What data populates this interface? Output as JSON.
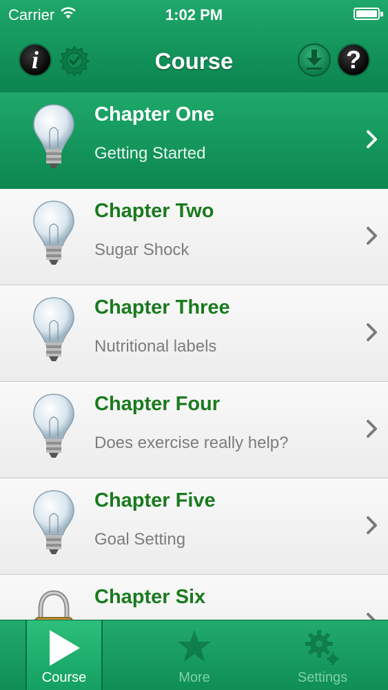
{
  "status_bar": {
    "carrier": "Carrier",
    "time": "1:02 PM"
  },
  "nav": {
    "title": "Course",
    "info_glyph": "i",
    "help_glyph": "?"
  },
  "chapters": [
    {
      "title": "Chapter One",
      "subtitle": "Getting Started",
      "icon": "lightbulb-icon",
      "selected": true
    },
    {
      "title": "Chapter Two",
      "subtitle": "Sugar Shock",
      "icon": "lightbulb-icon",
      "selected": false
    },
    {
      "title": "Chapter Three",
      "subtitle": "Nutritional labels",
      "icon": "lightbulb-icon",
      "selected": false
    },
    {
      "title": "Chapter Four",
      "subtitle": "Does exercise really help?",
      "icon": "lightbulb-icon",
      "selected": false
    },
    {
      "title": "Chapter Five",
      "subtitle": "Goal Setting",
      "icon": "lightbulb-icon",
      "selected": false
    },
    {
      "title": "Chapter Six",
      "subtitle": "",
      "icon": "padlock-icon",
      "selected": false
    }
  ],
  "tabs": [
    {
      "label": "Course",
      "icon": "play-icon",
      "active": true
    },
    {
      "label": "More",
      "icon": "star-icon",
      "active": false
    },
    {
      "label": "Settings",
      "icon": "gear-icon",
      "active": false
    }
  ],
  "colors": {
    "accent_green": "#14965c",
    "title_green": "#1a7a1e"
  }
}
